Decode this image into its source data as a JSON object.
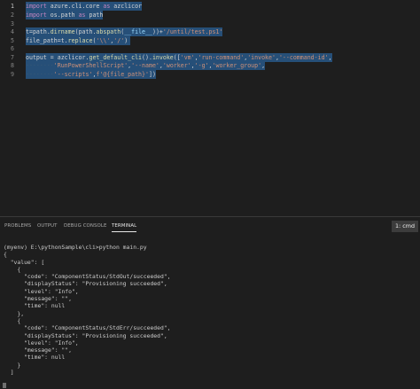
{
  "editor": {
    "lines": [
      {
        "n": "1",
        "segs": [
          {
            "t": "import",
            "c": "kw"
          },
          {
            "t": " azure.cli.core ",
            "c": "tx"
          },
          {
            "t": "as",
            "c": "kw"
          },
          {
            "t": " azclicor",
            "c": "tx"
          }
        ]
      },
      {
        "n": "2",
        "segs": [
          {
            "t": "import",
            "c": "kw"
          },
          {
            "t": " os.path ",
            "c": "tx"
          },
          {
            "t": "as",
            "c": "kw"
          },
          {
            "t": " path",
            "c": "tx"
          }
        ]
      },
      {
        "n": "3",
        "segs": []
      },
      {
        "n": "4",
        "segs": [
          {
            "t": "t=path.",
            "c": "tx"
          },
          {
            "t": "dirname",
            "c": "fn"
          },
          {
            "t": "(path.",
            "c": "tx"
          },
          {
            "t": "abspath",
            "c": "fn"
          },
          {
            "t": "(",
            "c": "tx"
          },
          {
            "t": "__file__",
            "c": "var"
          },
          {
            "t": "))+",
            "c": "tx"
          },
          {
            "t": "'/until/test.ps1'",
            "c": "str"
          }
        ]
      },
      {
        "n": "5",
        "segs": [
          {
            "t": "file_path=t.",
            "c": "tx"
          },
          {
            "t": "replace",
            "c": "fn"
          },
          {
            "t": "(",
            "c": "tx"
          },
          {
            "t": "'\\\\'",
            "c": "str"
          },
          {
            "t": ",",
            "c": "tx"
          },
          {
            "t": "'/'",
            "c": "str"
          },
          {
            "t": ")",
            "c": "tx"
          }
        ]
      },
      {
        "n": "6",
        "segs": []
      },
      {
        "n": "7",
        "segs": [
          {
            "t": "output = azclicor.",
            "c": "tx"
          },
          {
            "t": "get_default_cli",
            "c": "fn"
          },
          {
            "t": "().",
            "c": "tx"
          },
          {
            "t": "invoke",
            "c": "fn"
          },
          {
            "t": "([",
            "c": "tx"
          },
          {
            "t": "'vm'",
            "c": "str"
          },
          {
            "t": ",",
            "c": "tx"
          },
          {
            "t": "'run-command'",
            "c": "str"
          },
          {
            "t": ",",
            "c": "tx"
          },
          {
            "t": "'invoke'",
            "c": "str"
          },
          {
            "t": ",",
            "c": "tx"
          },
          {
            "t": "'--command-id'",
            "c": "str"
          },
          {
            "t": ",",
            "c": "tx"
          }
        ]
      },
      {
        "n": "8",
        "segs": [
          {
            "t": "········",
            "c": "ws"
          },
          {
            "t": "'RunPowerShellScript'",
            "c": "str"
          },
          {
            "t": ",",
            "c": "tx"
          },
          {
            "t": "'--name'",
            "c": "str"
          },
          {
            "t": ",",
            "c": "tx"
          },
          {
            "t": "'worker'",
            "c": "str"
          },
          {
            "t": ",",
            "c": "tx"
          },
          {
            "t": "'-g'",
            "c": "str"
          },
          {
            "t": ",",
            "c": "tx"
          },
          {
            "t": "'worker_group'",
            "c": "str"
          },
          {
            "t": ",",
            "c": "tx"
          }
        ]
      },
      {
        "n": "9",
        "segs": [
          {
            "t": "········",
            "c": "ws"
          },
          {
            "t": "'--scripts'",
            "c": "str"
          },
          {
            "t": ",",
            "c": "tx"
          },
          {
            "t": "f'@{file_path}'",
            "c": "str"
          },
          {
            "t": "])",
            "c": "tx"
          }
        ]
      }
    ]
  },
  "panel": {
    "tabs": [
      "PROBLEMS",
      "OUTPUT",
      "DEBUG CONSOLE",
      "TERMINAL"
    ],
    "terminal_select": "1: cmd",
    "terminal_lines": [
      "(myenv) E:\\pythonSample\\cli>python main.py",
      "{",
      "  \"value\": [",
      "    {",
      "      \"code\": \"ComponentStatus/StdOut/succeeded\",",
      "      \"displayStatus\": \"Provisioning succeeded\",",
      "      \"level\": \"Info\",",
      "      \"message\": \"\",",
      "      \"time\": null",
      "    },",
      "    {",
      "      \"code\": \"ComponentStatus/StdErr/succeeded\",",
      "      \"displayStatus\": \"Provisioning succeeded\",",
      "      \"level\": \"Info\",",
      "      \"message\": \"\",",
      "      \"time\": null",
      "    }",
      "  ]"
    ]
  }
}
